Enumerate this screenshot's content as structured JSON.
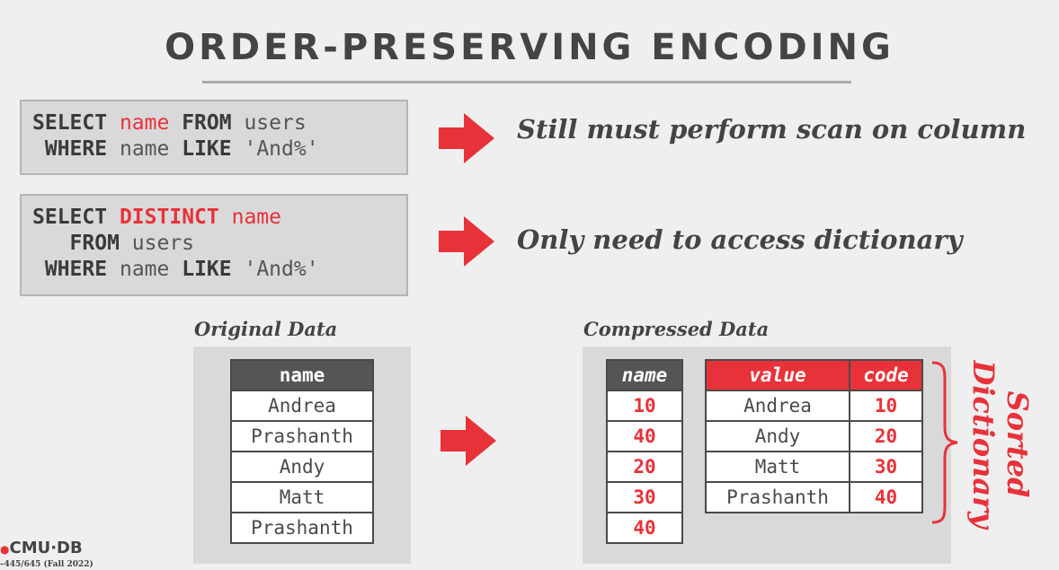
{
  "title": "ORDER-PRESERVING ENCODING",
  "query1": {
    "select_kw": "SELECT",
    "col": "name",
    "from_kw": "FROM",
    "table": "users",
    "where_kw": "WHERE",
    "where_col": "name",
    "like_kw": "LIKE",
    "pattern": "'And%'"
  },
  "query2": {
    "select_kw": "SELECT",
    "distinct_kw": "DISTINCT",
    "col": "name",
    "from_kw": "FROM",
    "table": "users",
    "where_kw": "WHERE",
    "where_col": "name",
    "like_kw": "LIKE",
    "pattern": "'And%'"
  },
  "note1": "Still must perform scan on column",
  "note2": "Only need to access dictionary",
  "original": {
    "caption": "Original Data",
    "header": "name",
    "rows": [
      "Andrea",
      "Prashanth",
      "Andy",
      "Matt",
      "Prashanth"
    ]
  },
  "compressed": {
    "caption": "Compressed Data",
    "name_header": "name",
    "codes": [
      "10",
      "40",
      "20",
      "30",
      "40"
    ],
    "dict_value_header": "value",
    "dict_code_header": "code",
    "dict": [
      {
        "value": "Andrea",
        "code": "10"
      },
      {
        "value": "Andy",
        "code": "20"
      },
      {
        "value": "Matt",
        "code": "30"
      },
      {
        "value": "Prashanth",
        "code": "40"
      }
    ]
  },
  "sorted_label": {
    "line1": "Sorted",
    "line2": "Dictionary"
  },
  "footer": {
    "logo": "CMU·DB",
    "course": "–445/645 (Fall 2022)"
  },
  "colors": {
    "accent": "#e8323a",
    "text": "#444444",
    "panel": "#d9d9d9"
  }
}
